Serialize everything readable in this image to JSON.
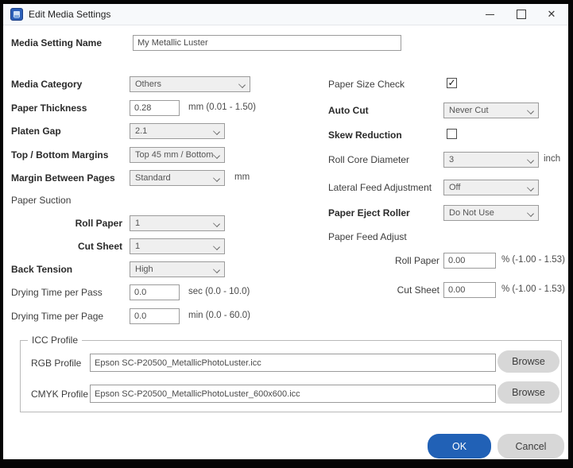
{
  "window": {
    "title": "Edit Media Settings",
    "controls": {
      "minimize": "minimize",
      "maximize": "maximize",
      "close": "✕"
    }
  },
  "colors": {
    "accent_blue": "#2161b6",
    "titlebar_bg": "#f7f9fb",
    "control_bg": "#efefef",
    "frame": "#050505"
  },
  "icons": {
    "app_icon": "media-installer-icon",
    "check_mark": "✓"
  },
  "form": {
    "media_setting_name": {
      "label": "Media Setting Name",
      "value": "My Metallic Luster"
    },
    "media_category": {
      "label": "Media Category",
      "value": "Others"
    },
    "paper_thickness": {
      "label": "Paper Thickness",
      "value": "0.28",
      "unit": "mm (0.01 - 1.50)"
    },
    "platen_gap": {
      "label": "Platen Gap",
      "value": "2.1"
    },
    "top_bottom_margins": {
      "label": "Top / Bottom Margins",
      "value": "Top 45 mm / Bottom"
    },
    "margin_between_pages": {
      "label": "Margin Between Pages",
      "value": "Standard",
      "unit": "mm"
    },
    "paper_suction": {
      "label": "Paper Suction"
    },
    "suction_roll_paper": {
      "label": "Roll Paper",
      "value": "1"
    },
    "suction_cut_sheet": {
      "label": "Cut Sheet",
      "value": "1"
    },
    "back_tension": {
      "label": "Back Tension",
      "value": "High"
    },
    "drying_time_per_pass": {
      "label": "Drying Time per Pass",
      "value": "0.0",
      "unit": "sec (0.0 - 10.0)"
    },
    "drying_time_per_page": {
      "label": "Drying Time per Page",
      "value": "0.0",
      "unit": "min (0.0 - 60.0)"
    },
    "paper_size_check": {
      "label": "Paper Size Check",
      "checked": true
    },
    "auto_cut": {
      "label": "Auto Cut",
      "value": "Never Cut"
    },
    "skew_reduction": {
      "label": "Skew Reduction",
      "checked": false
    },
    "roll_core_diameter": {
      "label": "Roll Core Diameter",
      "value": "3",
      "unit": "inch"
    },
    "lateral_feed_adjustment": {
      "label": "Lateral Feed Adjustment",
      "value": "Off"
    },
    "paper_eject_roller": {
      "label": "Paper Eject Roller",
      "value": "Do Not Use"
    },
    "paper_feed_adjust": {
      "label": "Paper Feed Adjust"
    },
    "feed_roll_paper": {
      "label": "Roll Paper",
      "value": "0.00",
      "unit": "% (-1.00 - 1.53)"
    },
    "feed_cut_sheet": {
      "label": "Cut Sheet",
      "value": "0.00",
      "unit": "% (-1.00 - 1.53)"
    }
  },
  "icc_profile": {
    "group_label": "ICC Profile",
    "rgb": {
      "label": "RGB Profile",
      "value": "Epson SC-P20500_MetallicPhotoLuster.icc",
      "button": "Browse"
    },
    "cmyk": {
      "label": "CMYK Profile",
      "value": "Epson SC-P20500_MetallicPhotoLuster_600x600.icc",
      "button": "Browse"
    }
  },
  "actions": {
    "ok": "OK",
    "cancel": "Cancel"
  }
}
